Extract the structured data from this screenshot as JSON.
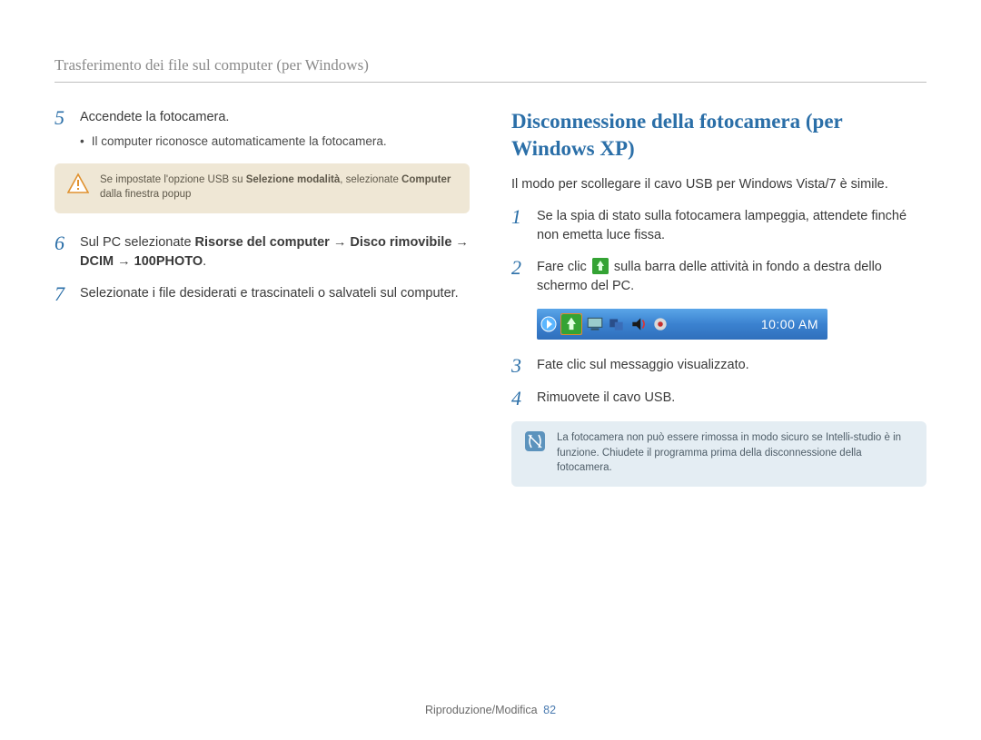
{
  "header": {
    "title": "Trasferimento dei file sul computer (per Windows)"
  },
  "left": {
    "step5": {
      "n": "5",
      "text": "Accendete la fotocamera.",
      "bullet": "Il computer riconosce automaticamente la fotocamera."
    },
    "warn": {
      "t1": "Se impostate l'opzione USB su ",
      "b1": "Selezione modalità",
      "t2": ", selezionate ",
      "b2": "Computer",
      "t3": " dalla finestra popup"
    },
    "step6": {
      "n": "6",
      "t1": "Sul PC selezionate ",
      "b1": "Risorse del computer",
      "t2": " → ",
      "b2": "Disco rimovibile",
      "t3": " → ",
      "b3": "DCIM",
      "t4": " → ",
      "b4": "100PHOTO",
      "t5": "."
    },
    "step7": {
      "n": "7",
      "text": "Selezionate i file desiderati e trascinateli o salvateli sul computer."
    }
  },
  "right": {
    "heading": "Disconnessione della fotocamera (per Windows XP)",
    "intro": "Il modo per scollegare il cavo USB per Windows Vista/7 è simile.",
    "step1": {
      "n": "1",
      "text": "Se la spia di stato sulla fotocamera lampeggia, attendete finché non emetta luce fissa."
    },
    "step2": {
      "n": "2",
      "t1": "Fare clic ",
      "t2": " sulla barra delle attività in fondo a destra dello schermo del PC."
    },
    "taskbar": {
      "clock": "10:00 AM"
    },
    "step3": {
      "n": "3",
      "text": "Fate clic sul messaggio visualizzato."
    },
    "step4": {
      "n": "4",
      "text": "Rimuovete il cavo USB."
    },
    "note": {
      "text": "La fotocamera non può essere rimossa in modo sicuro se Intelli-studio è in funzione. Chiudete il programma prima della disconnessione della fotocamera."
    }
  },
  "footer": {
    "section": "Riproduzione/Modifica",
    "page": "82"
  }
}
